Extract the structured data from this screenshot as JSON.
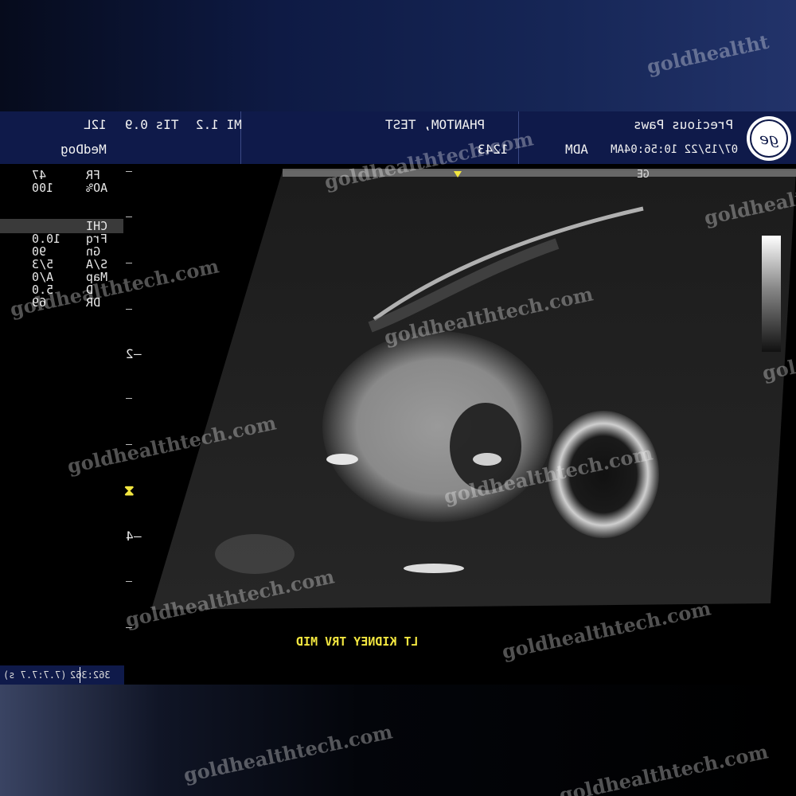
{
  "header": {
    "transducer": "12L",
    "preset": "MedDog",
    "tis": "TIs 0.9",
    "mi": "MI 1.2",
    "patient_name": "PHANTOM, TEST",
    "patient_id": "1243",
    "institution": "Precious Paws",
    "operator": "ADM",
    "datetime": "07/15/22 10:56:04AM"
  },
  "parameters": [
    {
      "key": "FR",
      "value": "47"
    },
    {
      "key": "AO%",
      "value": "100"
    },
    {
      "key": "CHI",
      "value": ""
    },
    {
      "key": "Frq",
      "value": "10.0"
    },
    {
      "key": "Gn",
      "value": "90"
    },
    {
      "key": "S/A",
      "value": "5/3"
    },
    {
      "key": "Map",
      "value": "A/0"
    },
    {
      "key": "D",
      "value": "5.0"
    },
    {
      "key": "DR",
      "value": "69"
    }
  ],
  "depth_labels": [
    "2",
    "4"
  ],
  "probe_label": "GE",
  "image_label": "LT KIDNEY TRV MID",
  "status": {
    "cine": "(7.7:7.7 s)",
    "frames": "362:362"
  },
  "watermark_text": [
    "goldhealtht",
    "goldhealthtech.com"
  ],
  "colors": {
    "header_bg": "#0f1a4a",
    "accent_yellow": "#f2e640",
    "text": "#f2f2f2"
  }
}
